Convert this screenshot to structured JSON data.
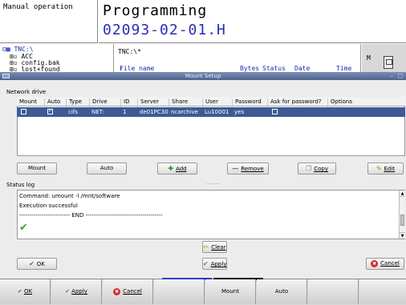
{
  "header": {
    "mode": "Manual operation",
    "title": "Programming",
    "file": "02093-02-01.H"
  },
  "file_manager": {
    "tree": [
      "TNC:\\",
      "ACC",
      "config.bak",
      "lost+found"
    ],
    "path": "TNC:\\*",
    "columns": [
      "File name",
      "Bytes",
      "Status",
      "Date",
      "Time"
    ],
    "side_label": "M"
  },
  "dialog": {
    "title": "Mount Setup",
    "network_label": "Network drive",
    "columns": [
      "Mount",
      "Auto",
      "Type",
      "Drive",
      "ID",
      "Server",
      "Share",
      "User",
      "Password",
      "Ask for password?",
      "Options"
    ],
    "row": {
      "type": "cifs",
      "drive": "NET:",
      "id": "1",
      "server": "de01PC30",
      "share": "ncarchive",
      "user": "Lu10001",
      "password": "yes"
    },
    "buttons": {
      "mount": "Mount",
      "auto": "Auto",
      "add": "Add",
      "remove": "Remove",
      "copy": "Copy",
      "edit": "Edit"
    },
    "splitter": "......",
    "status_label": "Status log",
    "log_lines": [
      "Command: umount -l /mnt/software",
      "Execution successful",
      "------------------------- END --------------------------------------"
    ],
    "clear": "Clear",
    "ok": "OK",
    "apply": "Apply",
    "cancel": "Cancel"
  },
  "softkeys": {
    "ok": "OK",
    "apply": "Apply",
    "cancel": "Cancel",
    "mount": "Mount",
    "auto": "Auto"
  },
  "colors": {
    "selection": "#3c5b96",
    "title_bar": "#4d6390",
    "file_blue": "#2b2bb8",
    "active_tab": "#1f3fd6",
    "inactive_tab": "#111111"
  },
  "icons": {
    "checkmark": "check-icon",
    "add": "plus-icon",
    "remove": "minus-icon",
    "copy": "copy-icon",
    "edit": "edit-icon",
    "clear": "broom-icon",
    "cancel": "cancel-icon"
  }
}
